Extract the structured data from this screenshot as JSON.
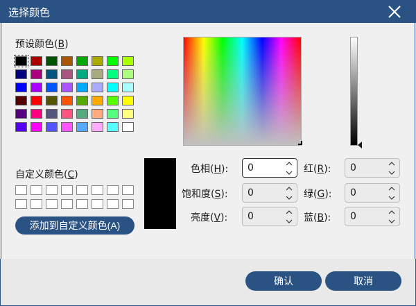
{
  "window": {
    "title": "选择颜色"
  },
  "basic_colors": {
    "label": "预设颜色(",
    "hotkey": "B",
    "label_end": ")",
    "swatches": [
      "#000000",
      "#aa0000",
      "#005500",
      "#aa5500",
      "#00aa00",
      "#aaaa00",
      "#00ff00",
      "#aaff00",
      "#000080",
      "#aa0080",
      "#005580",
      "#aa5580",
      "#00aa80",
      "#aaaa80",
      "#00ff80",
      "#aaff80",
      "#0000ff",
      "#aa00ff",
      "#0055ff",
      "#aa55ff",
      "#00aaff",
      "#aaaaff",
      "#00ffff",
      "#aaffff",
      "#550000",
      "#ff0000",
      "#555500",
      "#ff5500",
      "#55aa00",
      "#ffaa00",
      "#55ff00",
      "#ffff00",
      "#550080",
      "#ff0080",
      "#555580",
      "#ff5580",
      "#55aa80",
      "#ffaa80",
      "#55ff80",
      "#ffff80",
      "#5500ff",
      "#ff00ff",
      "#5555ff",
      "#ff55ff",
      "#55aaff",
      "#ffaaff",
      "#55ffff",
      "#ffffff"
    ]
  },
  "custom_colors": {
    "label": "自定义颜色(",
    "hotkey": "C",
    "label_end": ")",
    "count": 16,
    "add_button": "添加到自定义颜色(A)"
  },
  "fields": {
    "hue": {
      "label": "色相(",
      "hotkey": "H",
      "end": "):",
      "value": "0"
    },
    "sat": {
      "label": "饱和度(",
      "hotkey": "S",
      "end": "):",
      "value": "0"
    },
    "lum": {
      "label": "亮度(",
      "hotkey": "V",
      "end": "):",
      "value": "0"
    },
    "red": {
      "label": "红(",
      "hotkey": "R",
      "end": "):",
      "value": "0"
    },
    "green": {
      "label": "绿(",
      "hotkey": "G",
      "end": "):",
      "value": "0"
    },
    "blue": {
      "label": "蓝(",
      "hotkey": "B",
      "end": "):",
      "value": "0"
    }
  },
  "preview": {
    "color": "#000000"
  },
  "buttons": {
    "ok": "确认",
    "cancel": "取消"
  },
  "colors": {
    "accent": "#2a5383"
  }
}
